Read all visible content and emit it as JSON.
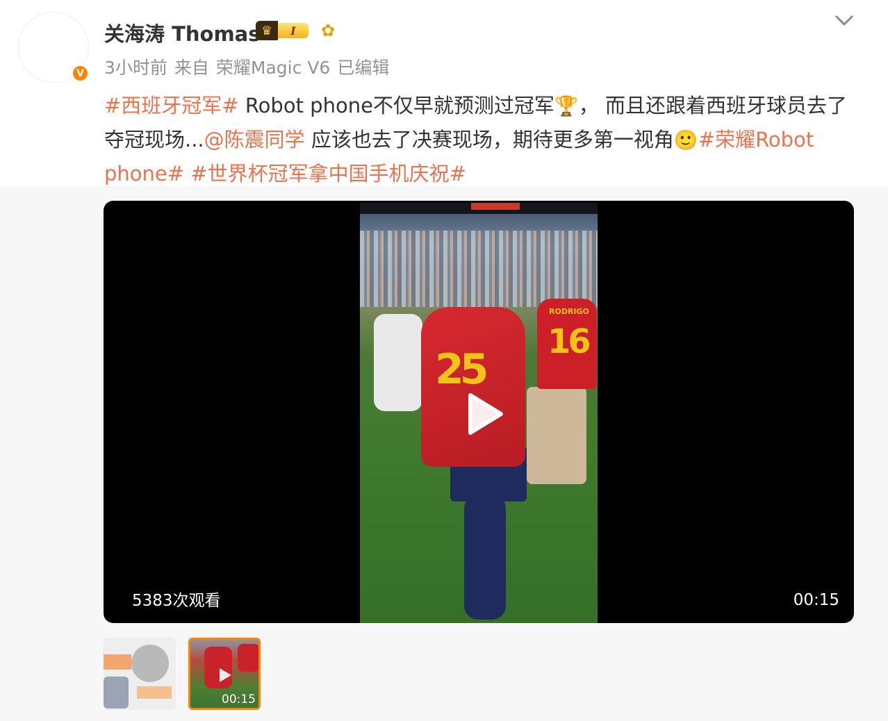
{
  "post": {
    "author": {
      "name": "关海涛 Thomas",
      "vip_level": "I",
      "verified_glyph": "V"
    },
    "meta": {
      "time": "3小时前",
      "source_prefix": "来自",
      "device": "荣耀Magic V6",
      "edited": "已编辑"
    },
    "content": {
      "tag1": "#西班牙冠军#",
      "text1": " Robot phone不仅早就预测过冠军",
      "trophy_emoji": "🏆",
      "text2": "，  而且还跟着西班牙球员去了夺冠现场...",
      "mention": "@陈震同学",
      "text3": " 应该也去了决赛现场，期待更多第一视角",
      "smile_emoji": "🙂",
      "tag2": "#荣耀Robot phone#",
      "tag3": "#世界杯冠军拿中国手机庆祝#"
    },
    "video": {
      "views": "5383次观看",
      "duration": "00:15",
      "jersey_left_number": "25",
      "jersey_right_number": "16",
      "jersey_right_name": "RODRIGO"
    },
    "thumbnails": [
      {
        "label": "thumbnail-1"
      },
      {
        "label": "thumbnail-2",
        "duration": "00:15"
      }
    ]
  },
  "colors": {
    "accent_orange": "#ff8200",
    "link_orange": "#eb7350",
    "text_dark": "#333333",
    "text_gray": "#939393"
  },
  "icons": [
    "verified-icon",
    "vip-crown-icon",
    "fan-badge-icon",
    "chevron-down-icon",
    "play-icon"
  ]
}
